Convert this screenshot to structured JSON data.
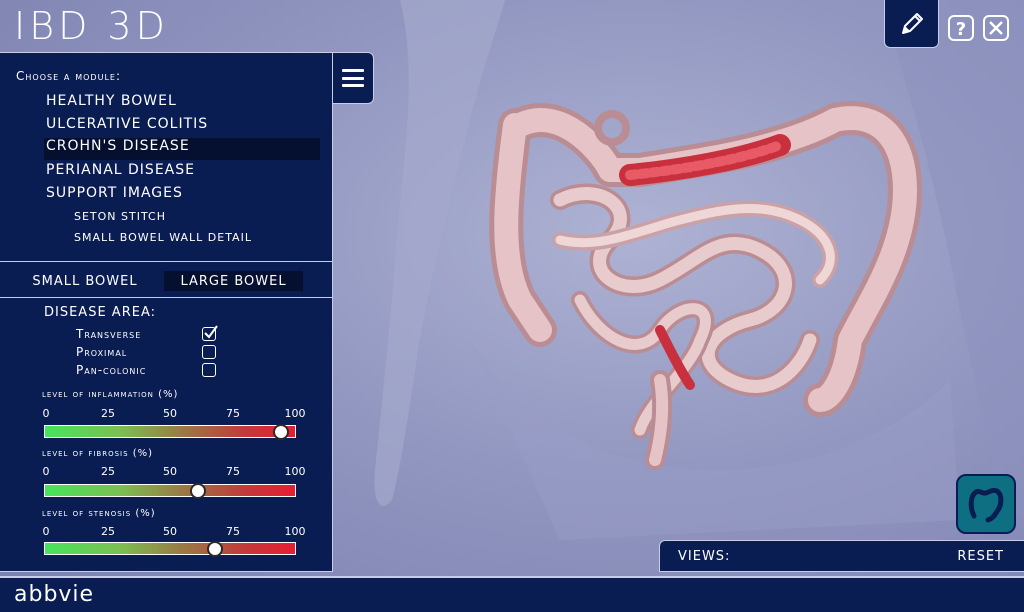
{
  "app": {
    "title": "IBD 3D"
  },
  "module_panel": {
    "heading": "Choose a module:",
    "modules": [
      "HEALTHY BOWEL",
      "ULCERATIVE COLITIS",
      "CROHN'S DISEASE",
      "PERIANAL DISEASE",
      "SUPPORT IMAGES"
    ],
    "selected_module": "CROHN'S DISEASE",
    "submodules": [
      "SETON STITCH",
      "SMALL BOWEL WALL DETAIL"
    ]
  },
  "bowel_toggle": {
    "options": [
      "SMALL BOWEL",
      "LARGE BOWEL"
    ],
    "selected": "LARGE BOWEL"
  },
  "disease_area": {
    "title": "DISEASE AREA:",
    "options": [
      {
        "label": "Transverse",
        "checked": true
      },
      {
        "label": "Proximal",
        "checked": false
      },
      {
        "label": "Pan-colonic",
        "checked": false
      }
    ]
  },
  "sliders": [
    {
      "title": "level of inflammation (%)",
      "value": 94
    },
    {
      "title": "level of fibrosis (%)",
      "value": 61
    },
    {
      "title": "level of stenosis (%)",
      "value": 68
    }
  ],
  "slider_ticks": [
    "0",
    "25",
    "50",
    "75",
    "100"
  ],
  "views": {
    "label": "VIEWS:",
    "reset_label": "RESET"
  },
  "footer": {
    "brand": "abbvie"
  },
  "icons": {
    "menu": "hamburger-icon",
    "edit": "pencil-icon",
    "help": "question-icon",
    "close": "close-icon",
    "anatomy": "colon-icon"
  },
  "colors": {
    "panel": "#0a1d52",
    "background": "#9297c1",
    "slider_low": "#46e45c",
    "slider_high": "#e81e32",
    "anatomy_button": "#0e6f82"
  }
}
